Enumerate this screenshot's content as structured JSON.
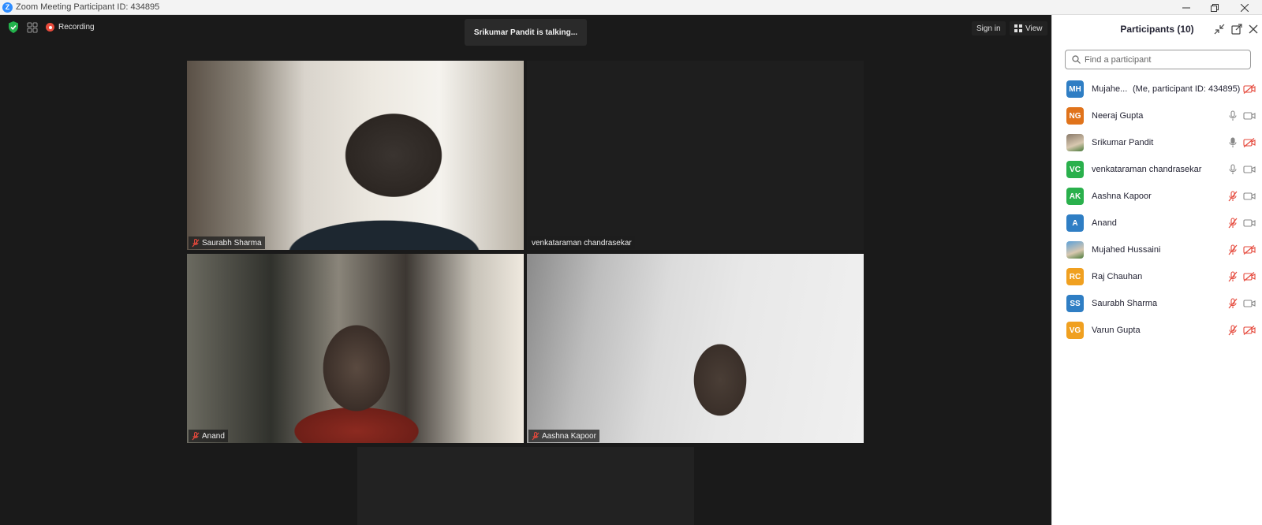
{
  "window": {
    "title": "Zoom Meeting Participant ID: 434895",
    "logo_letter": "Z"
  },
  "toolbar": {
    "recording_label": "Recording",
    "talking_indicator": "Srikumar Pandit is talking...",
    "sign_in_label": "Sign in",
    "view_label": "View"
  },
  "tiles": [
    {
      "name": "Saurabh Sharma",
      "muted": true
    },
    {
      "name": "venkataraman chandrasekar",
      "muted": false
    },
    {
      "name": "Anand",
      "muted": true
    },
    {
      "name": "Aashna Kapoor",
      "muted": true
    }
  ],
  "panel": {
    "title": "Participants (10)",
    "search_placeholder": "Find a participant",
    "participants": [
      {
        "initials": "MH",
        "color": "#2f7ec4",
        "name": "Mujahe...",
        "suffix": "(Me, participant ID: 434895)",
        "mic": "none",
        "camera": "off"
      },
      {
        "initials": "NG",
        "color": "#e0731b",
        "name": "Neeraj Gupta",
        "mic": "on",
        "camera": "on"
      },
      {
        "initials": "",
        "color": "#8a7a6a",
        "name": "Srikumar Pandit",
        "mic": "talking",
        "camera": "off",
        "photo": true
      },
      {
        "initials": "VC",
        "color": "#2ab04c",
        "name": "venkataraman chandrasekar",
        "mic": "on",
        "camera": "on"
      },
      {
        "initials": "AK",
        "color": "#2ab04c",
        "name": "Aashna Kapoor",
        "mic": "off",
        "camera": "on"
      },
      {
        "initials": "A",
        "color": "#2f7ec4",
        "name": "Anand",
        "mic": "off",
        "camera": "on"
      },
      {
        "initials": "",
        "color": "#5aa0d8",
        "name": "Mujahed Hussaini",
        "mic": "off",
        "camera": "off",
        "photo": true
      },
      {
        "initials": "RC",
        "color": "#f0a020",
        "name": "Raj Chauhan",
        "mic": "off",
        "camera": "off"
      },
      {
        "initials": "SS",
        "color": "#2f7ec4",
        "name": "Saurabh Sharma",
        "mic": "off",
        "camera": "on"
      },
      {
        "initials": "VG",
        "color": "#f0a020",
        "name": "Varun Gupta",
        "mic": "off",
        "camera": "off"
      }
    ]
  }
}
